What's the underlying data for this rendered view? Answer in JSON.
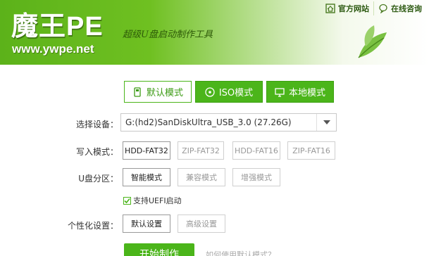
{
  "header": {
    "logo_title": "魔王PE",
    "logo_url": "www.ywpe.net",
    "slogan": "超级U盘启动制作工具",
    "links": [
      {
        "label": "官方网站",
        "icon": "home-icon"
      },
      {
        "label": "在线咨询",
        "icon": "chat-bubble-icon"
      }
    ]
  },
  "tabs": [
    {
      "label": "默认模式",
      "icon": "usb-icon",
      "active": true
    },
    {
      "label": "ISO模式",
      "icon": "disc-icon",
      "active": false
    },
    {
      "label": "本地模式",
      "icon": "monitor-icon",
      "active": false
    }
  ],
  "form": {
    "device_label": "选择设备：",
    "device_value": "G:(hd2)SanDiskUltra_USB_3.0 (27.26G)",
    "write_mode_label": "写入模式：",
    "write_modes": [
      "HDD-FAT32",
      "ZIP-FAT32",
      "HDD-FAT16",
      "ZIP-FAT16"
    ],
    "partition_label": "U盘分区：",
    "partition_modes": [
      "智能模式",
      "兼容模式",
      "增强模式"
    ],
    "uefi_label": "支持UEFI启动",
    "uefi_checked": true,
    "personal_label": "个性化设置：",
    "personal_options": [
      "默认设置",
      "高级设置"
    ],
    "start_button": "开始制作",
    "hint": "如何使用默认模式？"
  },
  "colors": {
    "accent": "#4bb51a",
    "header_start": "#5cb21a"
  }
}
